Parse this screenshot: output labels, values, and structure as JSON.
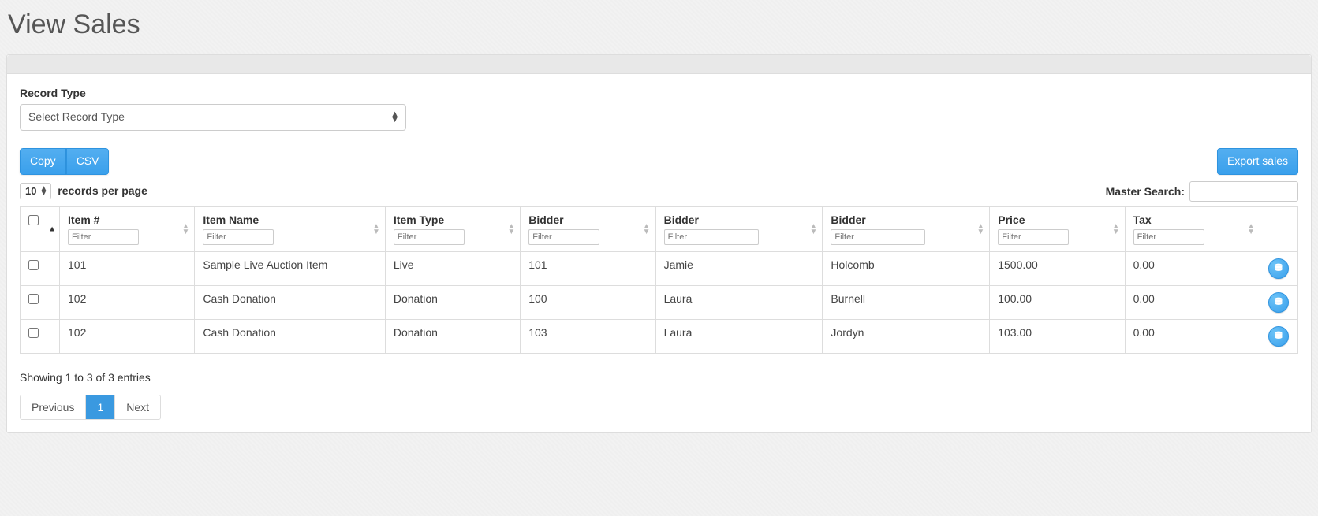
{
  "page": {
    "title": "View Sales"
  },
  "form": {
    "record_type_label": "Record Type",
    "record_type_placeholder": "Select Record Type"
  },
  "toolbar": {
    "copy_label": "Copy",
    "csv_label": "CSV",
    "export_label": "Export sales"
  },
  "length": {
    "value": "10",
    "suffix": "records per page"
  },
  "search": {
    "label": "Master Search:",
    "value": ""
  },
  "columns": {
    "item_no": "Item #",
    "item_name": "Item Name",
    "item_type": "Item Type",
    "bidder_no": "Bidder",
    "bidder_first": "Bidder",
    "bidder_last": "Bidder",
    "price": "Price",
    "tax": "Tax",
    "filter_placeholder": "Filter"
  },
  "rows": [
    {
      "item_no": "101",
      "item_name": "Sample Live Auction Item",
      "item_type": "Live",
      "bidder_no": "101",
      "bidder_first": "Jamie",
      "bidder_last": "Holcomb",
      "price": "1500.00",
      "tax": "0.00"
    },
    {
      "item_no": "102",
      "item_name": "Cash Donation",
      "item_type": "Donation",
      "bidder_no": "100",
      "bidder_first": "Laura",
      "bidder_last": "Burnell",
      "price": "100.00",
      "tax": "0.00"
    },
    {
      "item_no": "102",
      "item_name": "Cash Donation",
      "item_type": "Donation",
      "bidder_no": "103",
      "bidder_first": "Laura",
      "bidder_last": "Jordyn",
      "price": "103.00",
      "tax": "0.00"
    }
  ],
  "info": "Showing 1 to 3 of 3 entries",
  "pagination": {
    "previous": "Previous",
    "page": "1",
    "next": "Next"
  }
}
